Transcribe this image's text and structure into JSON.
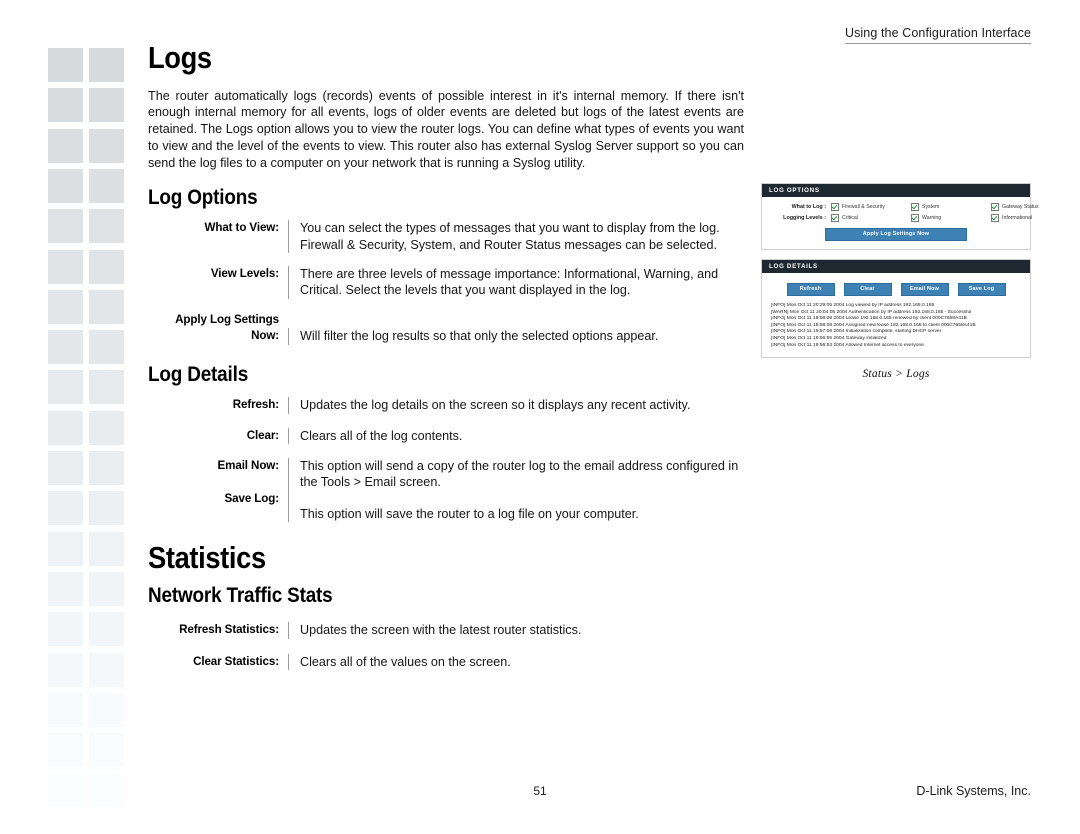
{
  "page": {
    "running_head": "Using the Configuration Interface",
    "page_number": "51",
    "company": "D-Link Systems, Inc."
  },
  "sections": [
    {
      "title": "Logs",
      "body": "The router automatically logs (records) events of possible interest in it's internal memory. If there isn't enough internal memory for all events, logs of older events are deleted but logs of the latest events are retained. The Logs option allows you to view the router logs. You can define what types of events you want to view and the level of the events to view. This router also has external Syslog Server support so you can send the log files to a computer on your network that is running a Syslog utility."
    }
  ],
  "log_options": {
    "heading": "Log Options",
    "items": [
      {
        "term": "What to View:",
        "desc": "You can select the types of messages that you want to display from the log. Firewall & Security, System, and Router Status messages can be selected."
      },
      {
        "term": "View Levels:",
        "desc": "There are three levels of message importance: Informational, Warning, and Critical. Select the levels that you want displayed in the log."
      },
      {
        "term_line1": "Apply Log Settings",
        "term_line2": "Now:",
        "desc": "Will filter the log results so that only the selected options appear."
      }
    ]
  },
  "log_details": {
    "heading": "Log Details",
    "items": [
      {
        "term": "Refresh:",
        "desc": "Updates the log details on the screen so it displays any recent activity."
      },
      {
        "term": "Clear:",
        "desc": "Clears all of the log contents."
      },
      {
        "term": "Email Now:",
        "desc": "This option will send a copy of the router log to the email address configured in the Tools > Email screen."
      },
      {
        "term": "Save Log:",
        "desc": "This option will save the router to a log file on your computer."
      }
    ]
  },
  "statistics": {
    "heading": "Statistics",
    "subheading": "Network Traffic Stats",
    "items": [
      {
        "term": "Refresh Statistics:",
        "desc": "Updates the screen with the latest router statistics."
      },
      {
        "term": "Clear Statistics:",
        "desc": "Clears all of the values on the screen."
      }
    ]
  },
  "figure": {
    "caption": "Status > Logs",
    "log_options_panel": {
      "title": "LOG OPTIONS",
      "rows": [
        {
          "label": "What to Log :",
          "options": [
            "Firewall & Security",
            "System",
            "Gateway Status"
          ]
        },
        {
          "label": "Logging Levels :",
          "options": [
            "Critical",
            "Warning",
            "Informational"
          ]
        }
      ],
      "apply_button": "Apply Log Settings Now"
    },
    "log_details_panel": {
      "title": "LOG DETAILS",
      "buttons": [
        "Refresh",
        "Clear",
        "Email Now",
        "Save Log"
      ],
      "log_lines": [
        "[INFO] Mon Oct 11 20:29:05 2004 Log viewed by IP address 192.168.0.165",
        "[WARN] Mon Oct 11 20:04:05 2004 Authentication by IP address 192.168.0.165 - Successful",
        "[INFO] Mon Oct 11 19:58:09 2004 Lease 192.168.0.165 renewed by client 000C7658A41B",
        "[INFO] Mon Oct 11 19:58:08 2004 Assigned new lease 192.168.0.165 to client 000C7658A41B",
        "[INFO] Mon Oct 11 19:57:08 2004 Initialization complete, starting DHCP server",
        "[INFO] Mon Oct 11 19:56:55 2004 Gateway initialized",
        "[INFO] Mon Oct 11 19:56:53 2004 Allowed Internet access to everyone"
      ]
    }
  }
}
